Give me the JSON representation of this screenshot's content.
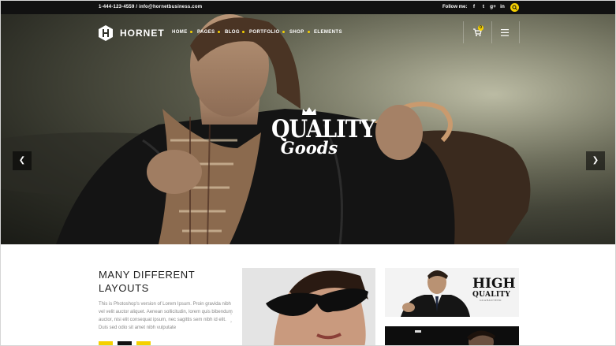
{
  "topbar": {
    "contact": "1-444-123-4559 / info@hornetbusiness.com",
    "follow_label": "Follow me:",
    "social": [
      {
        "icon": "facebook-icon",
        "glyph": "f"
      },
      {
        "icon": "twitter-icon",
        "glyph": "t"
      },
      {
        "icon": "google-plus-icon",
        "glyph": "g+"
      },
      {
        "icon": "linkedin-icon",
        "glyph": "in"
      }
    ]
  },
  "header": {
    "brand": "HORNET",
    "menu": [
      "HOME",
      "PAGES",
      "BLOG",
      "PORTFOLIO",
      "SHOP",
      "ELEMENTS"
    ],
    "cart_count": "0"
  },
  "hero": {
    "headline_1": "QUALITY",
    "headline_2": "Goods",
    "slide_count": 2,
    "active_slide": 1
  },
  "content": {
    "title": "MANY DIFFERENT LAYOUTS",
    "body": "This is Photoshop's version  of Lorem Ipsum. Proin gravida nibh vel velit auctor aliquet. Aenean sollicitudin, lorem quis bibendum auctor, nisi elit consequat ipsum, nec sagittis sem nibh id elit. Duis sed odio sit amet nibh vulputate"
  },
  "promo": {
    "high_1": "HIGH",
    "high_2": "QUALITY",
    "high_3": "GUARANTEED"
  },
  "colors": {
    "accent": "#f5d000",
    "dark": "#111111"
  }
}
